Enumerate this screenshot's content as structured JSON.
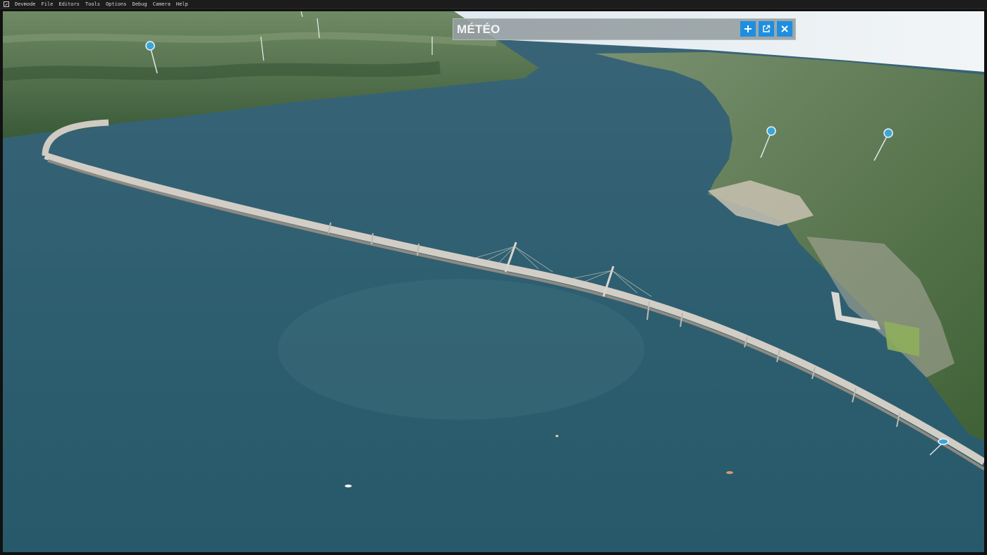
{
  "menubar": {
    "app_icon": "devmode-icon",
    "items": [
      "Devmode",
      "File",
      "Editors",
      "Tools",
      "Options",
      "Debug",
      "Camera",
      "Help"
    ]
  },
  "panel": {
    "title": "MÉTÉO",
    "buttons": {
      "add": "plus-icon",
      "undock": "external-window-icon",
      "close": "close-icon"
    },
    "accent_color": "#1e8fe0"
  },
  "scene": {
    "description_icons": [
      "map-pin-icon"
    ]
  }
}
